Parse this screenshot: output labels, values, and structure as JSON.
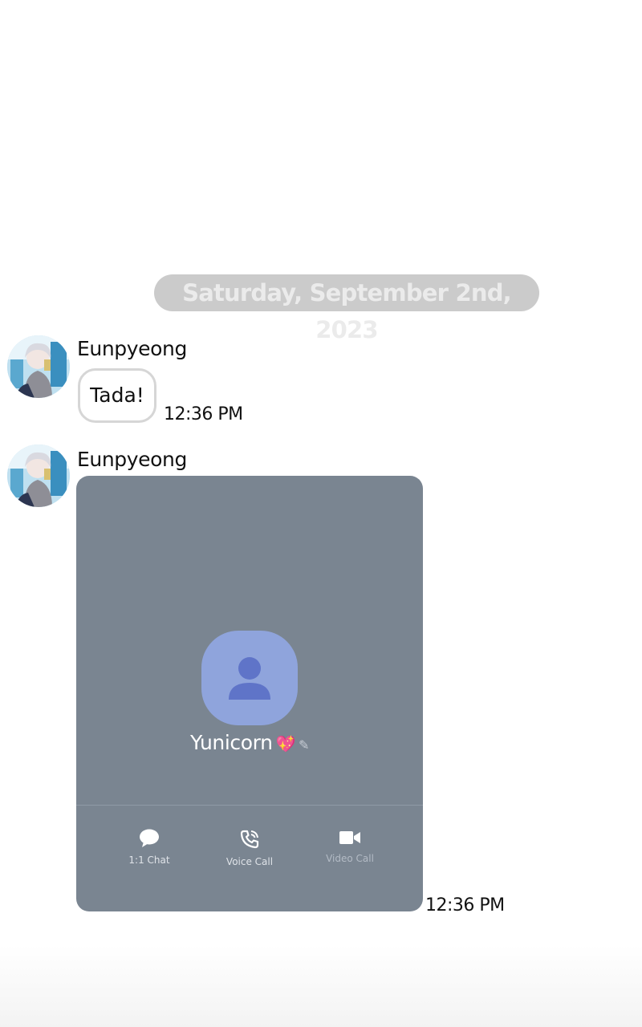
{
  "date_separator": "Saturday, September 2nd, 2023",
  "messages": [
    {
      "sender": "Eunpyeong",
      "type": "text",
      "text": "Tada!",
      "time": "12:36 PM"
    },
    {
      "sender": "Eunpyeong",
      "type": "profile_card",
      "time": "12:36 PM",
      "card": {
        "name": "Yunicorn",
        "name_emoji": "💖",
        "actions": [
          {
            "label": "1:1 Chat",
            "icon": "chat-bubble-icon"
          },
          {
            "label": "Voice Call",
            "icon": "phone-icon"
          },
          {
            "label": "Video Call",
            "icon": "video-camera-icon"
          }
        ]
      }
    }
  ],
  "colors": {
    "date_pill_bg": "#cbcbcb",
    "card_bg": "#7a8591",
    "profile_icon_bg": "#8fa4dc",
    "profile_icon_fg": "#5f74c8"
  }
}
